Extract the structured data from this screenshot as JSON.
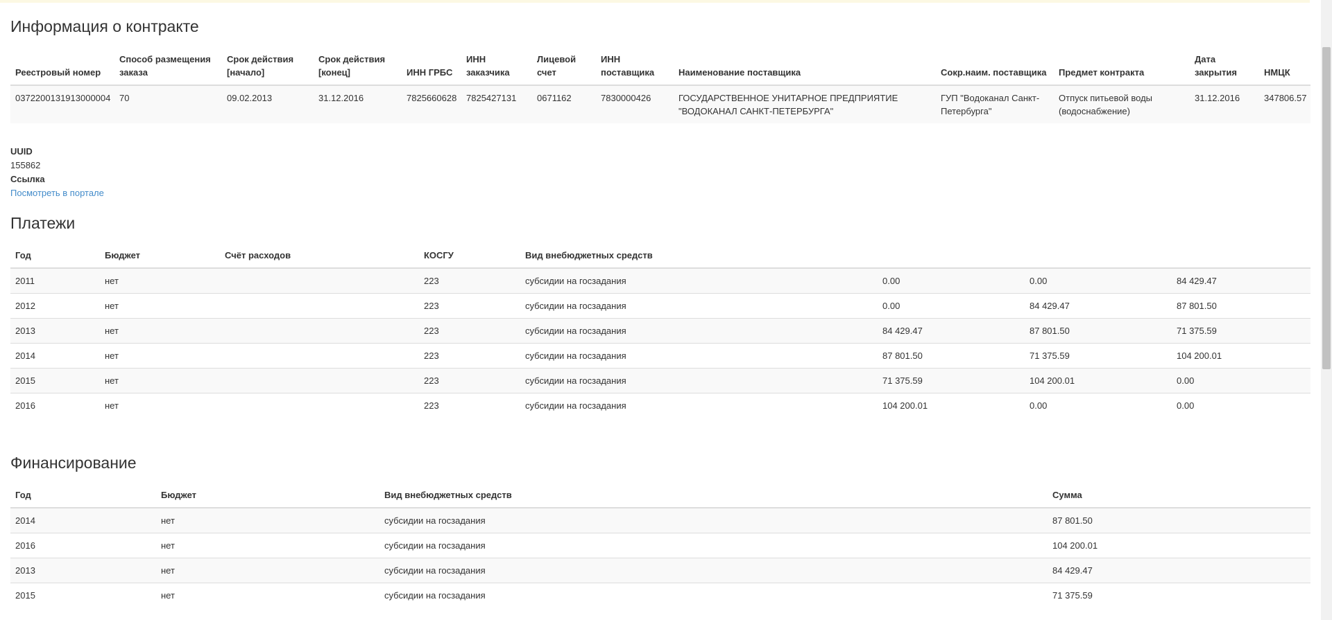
{
  "contract": {
    "title": "Информация о контракте",
    "columns": [
      "Реестровый номер",
      "Способ размещения заказа",
      "Срок действия [начало]",
      "Срок действия [конец]",
      "ИНН ГРБС",
      "ИНН заказчика",
      "Лицевой счет",
      "ИНН поставщика",
      "Наименование поставщика",
      "Сокр.наим. поставщика",
      "Предмет контракта",
      "Дата закрытия",
      "НМЦК"
    ],
    "row": [
      "0372200131913000004",
      "70",
      "09.02.2013",
      "31.12.2016",
      "7825660628",
      "7825427131",
      "0671162",
      "7830000426",
      "ГОСУДАРСТВЕННОЕ УНИТАРНОЕ ПРЕДПРИЯТИЕ \"ВОДОКАНАЛ САНКТ-ПЕТЕРБУРГА\"",
      "ГУП \"Водоканал Санкт-Петербурга\"",
      "Отпуск питьевой воды (водоснабжение)",
      "31.12.2016",
      "347806.57"
    ]
  },
  "meta": {
    "uuid_label": "UUID",
    "uuid_value": "155862",
    "link_label": "Ссылка",
    "link_text": "Посмотреть в портале"
  },
  "payments": {
    "title": "Платежи",
    "columns": [
      "Год",
      "Бюджет",
      "Счёт расходов",
      "КОСГУ",
      "Вид внебюджетных средств",
      "",
      "",
      ""
    ],
    "rows": [
      [
        "2011",
        "нет",
        "",
        "223",
        "субсидии на госзадания",
        "0.00",
        "0.00",
        "84 429.47"
      ],
      [
        "2012",
        "нет",
        "",
        "223",
        "субсидии на госзадания",
        "0.00",
        "84 429.47",
        "87 801.50"
      ],
      [
        "2013",
        "нет",
        "",
        "223",
        "субсидии на госзадания",
        "84 429.47",
        "87 801.50",
        "71 375.59"
      ],
      [
        "2014",
        "нет",
        "",
        "223",
        "субсидии на госзадания",
        "87 801.50",
        "71 375.59",
        "104 200.01"
      ],
      [
        "2015",
        "нет",
        "",
        "223",
        "субсидии на госзадания",
        "71 375.59",
        "104 200.01",
        "0.00"
      ],
      [
        "2016",
        "нет",
        "",
        "223",
        "субсидии на госзадания",
        "104 200.01",
        "0.00",
        "0.00"
      ]
    ]
  },
  "funding": {
    "title": "Финансирование",
    "columns": [
      "Год",
      "Бюджет",
      "Вид внебюджетных средств",
      "Сумма"
    ],
    "rows": [
      [
        "2014",
        "нет",
        "субсидии на госзадания",
        "87 801.50"
      ],
      [
        "2016",
        "нет",
        "субсидии на госзадания",
        "104 200.01"
      ],
      [
        "2013",
        "нет",
        "субсидии на госзадания",
        "84 429.47"
      ],
      [
        "2015",
        "нет",
        "субсидии на госзадания",
        "71 375.59"
      ]
    ]
  }
}
